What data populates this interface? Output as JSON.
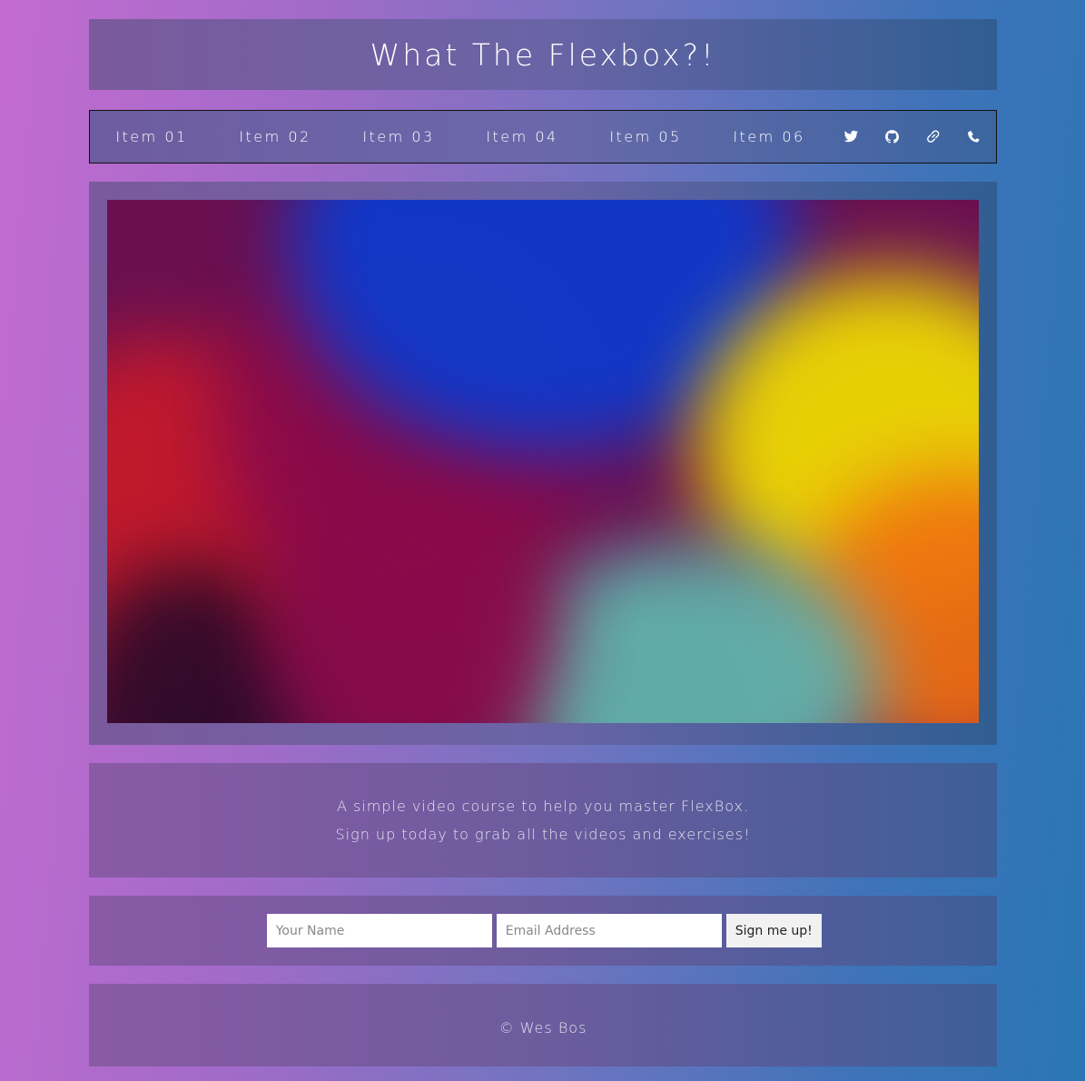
{
  "header": {
    "title": "What The Flexbox?!"
  },
  "nav": {
    "items": [
      {
        "label": "Item 01"
      },
      {
        "label": "Item 02"
      },
      {
        "label": "Item 03"
      },
      {
        "label": "Item 04"
      },
      {
        "label": "Item 05"
      },
      {
        "label": "Item 06"
      }
    ],
    "socials": [
      {
        "icon": "twitter-icon"
      },
      {
        "icon": "github-icon"
      },
      {
        "icon": "link-icon"
      },
      {
        "icon": "phone-icon"
      }
    ]
  },
  "hero": {
    "colors": [
      "#c81a2a",
      "#8a0a4a",
      "#0a3ad0",
      "#f2e000",
      "#f07010",
      "#60b8b0",
      "#2a0a2a"
    ]
  },
  "description": {
    "line1": "A simple video course to help you master FlexBox.",
    "line2": "Sign up today to grab all the videos and exercises!"
  },
  "signup": {
    "name_placeholder": "Your Name",
    "email_placeholder": "Email Address",
    "button_label": "Sign me up!"
  },
  "footer": {
    "text": "© Wes Bos"
  }
}
